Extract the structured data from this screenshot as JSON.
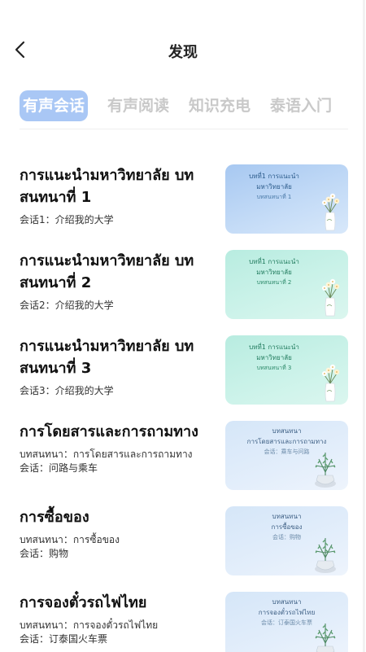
{
  "header": {
    "title": "发现",
    "back_icon": "chevron-left-icon"
  },
  "tabs": [
    {
      "label": "有声会话",
      "active": true
    },
    {
      "label": "有声阅读",
      "active": false
    },
    {
      "label": "知识充电",
      "active": false
    },
    {
      "label": "泰语入门",
      "active": false
    }
  ],
  "colors": {
    "tab_active_bg": "#a9c7f5",
    "tab_inactive": "#c9c9c9"
  },
  "items": [
    {
      "title": "การแนะนำมหาวิทยาลัย บทสนทนาที่ 1",
      "sub1": "会话1：介绍我的大学",
      "sub2": "",
      "thumb_style": "blue",
      "thumb": {
        "line1": "บทที่1 การแนะนำ",
        "line2": "มหาวิทยาลัย",
        "line3": "บทสนทนาที่ 1"
      },
      "thumb_icon": "flower-vase-icon"
    },
    {
      "title": "การแนะนำมหาวิทยาลัย บทสนทนาที่ 2",
      "sub1": "会话2：介绍我的大学",
      "sub2": "",
      "thumb_style": "green",
      "thumb": {
        "line1": "บทที่1 การแนะนำ",
        "line2": "มหาวิทยาลัย",
        "line3": "บทสนทนาที่ 2"
      },
      "thumb_icon": "flower-vase-icon"
    },
    {
      "title": "การแนะนำมหาวิทยาลัย บทสนทนาที่ 3",
      "sub1": "会话3：介绍我的大学",
      "sub2": "",
      "thumb_style": "green",
      "thumb": {
        "line1": "บทที่1 การแนะนำ",
        "line2": "มหาวิทยาลัย",
        "line3": "บทสนทนาที่ 3"
      },
      "thumb_icon": "flower-vase-icon"
    },
    {
      "title": "การโดยสารและการถามทาง",
      "sub1": "บทสนทนา：การโดยสารและการถามทาง",
      "sub2": "会话：问路与乘车",
      "thumb_style": "lightblue",
      "thumb": {
        "line1": "บทสนทนา",
        "line2": "การโดยสารและการถามทาง",
        "line3": "会话：乘车与问路"
      },
      "thumb_icon": "potted-plant-icon"
    },
    {
      "title": "การซื้อของ",
      "sub1": "บทสนทนา：การซื้อของ",
      "sub2": "会话：购物",
      "thumb_style": "lightblue",
      "thumb": {
        "line1": "บทสนทนา",
        "line2": "การซื้อของ",
        "line3": "会话：购物"
      },
      "thumb_icon": "potted-plant-icon"
    },
    {
      "title": "การจองตั๋วรถไฟไทย",
      "sub1": "บทสนทนา：การจองตั๋วรถไฟไทย",
      "sub2": "会话：订泰国火车票",
      "thumb_style": "lightblue",
      "thumb": {
        "line1": "บทสนทนา",
        "line2": "การจองตั๋วรถไฟไทย",
        "line3": "会话：订泰国火车票"
      },
      "thumb_icon": "potted-plant-icon"
    }
  ]
}
